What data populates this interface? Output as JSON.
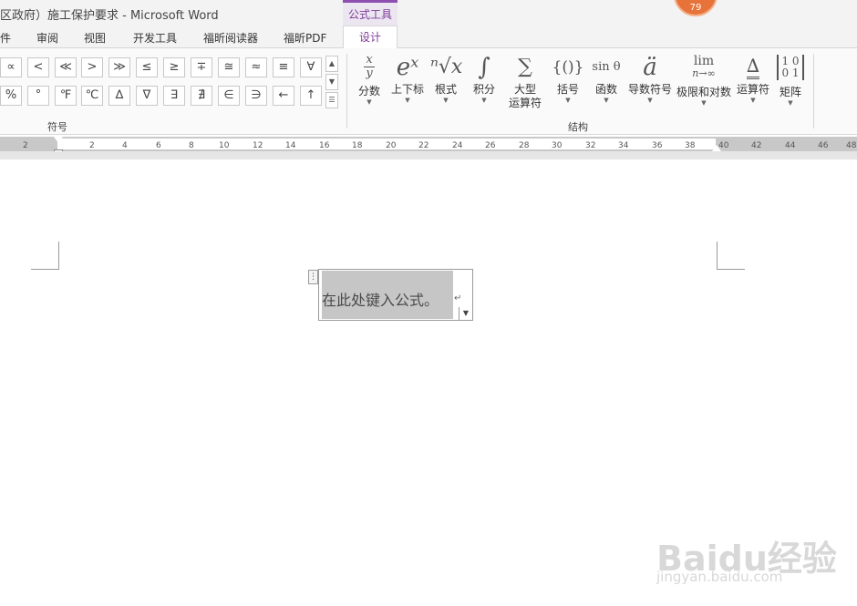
{
  "window": {
    "title": "区政府）施工保护要求 - Microsoft Word",
    "context_group": "公式工具",
    "notification_count": "79"
  },
  "tabs": [
    "件",
    "审阅",
    "视图",
    "开发工具",
    "福昕阅读器",
    "福昕PDF",
    "设计"
  ],
  "symbols": {
    "row1": [
      "∝",
      "<",
      "≪",
      ">",
      "≫",
      "≤",
      "≥",
      "∓",
      "≅",
      "≈",
      "≡",
      "∀"
    ],
    "row2": [
      "%",
      "°",
      "℉",
      "℃",
      "∆",
      "∇",
      "∃",
      "∄",
      "∈",
      "∋",
      "←",
      "↑"
    ],
    "group_label": "符号"
  },
  "structures": {
    "group_label": "结构",
    "buttons": [
      {
        "label": "分数",
        "icon": "fraction-icon"
      },
      {
        "label": "上下标",
        "icon": "script-icon",
        "glyph": "eˣ"
      },
      {
        "label": "根式",
        "icon": "radical-icon",
        "glyph": "ⁿ√x"
      },
      {
        "label": "积分",
        "icon": "integral-icon",
        "glyph": "∫"
      },
      {
        "label": "大型",
        "label2": "运算符",
        "icon": "large-operator-icon",
        "glyph": "∑"
      },
      {
        "label": "括号",
        "icon": "bracket-icon",
        "glyph": "{()}"
      },
      {
        "label": "函数",
        "icon": "function-icon",
        "glyph": "sin θ"
      },
      {
        "label": "导数符号",
        "icon": "accent-icon",
        "glyph": "ä"
      },
      {
        "label": "极限和对数",
        "icon": "limit-icon"
      },
      {
        "label": "运算符",
        "icon": "operator-icon",
        "glyph": "∆"
      },
      {
        "label": "矩阵",
        "icon": "matrix-icon"
      }
    ]
  },
  "ruler": {
    "ticks": [
      "2",
      "2",
      "4",
      "6",
      "8",
      "10",
      "12",
      "14",
      "16",
      "18",
      "20",
      "22",
      "24",
      "26",
      "28",
      "30",
      "32",
      "34",
      "36",
      "38",
      "40",
      "42",
      "44",
      "46",
      "48"
    ]
  },
  "equation": {
    "placeholder": "在此处键入公式。"
  },
  "watermark": {
    "brand": "Baidu经验",
    "url": "jingyan.baidu.com"
  }
}
